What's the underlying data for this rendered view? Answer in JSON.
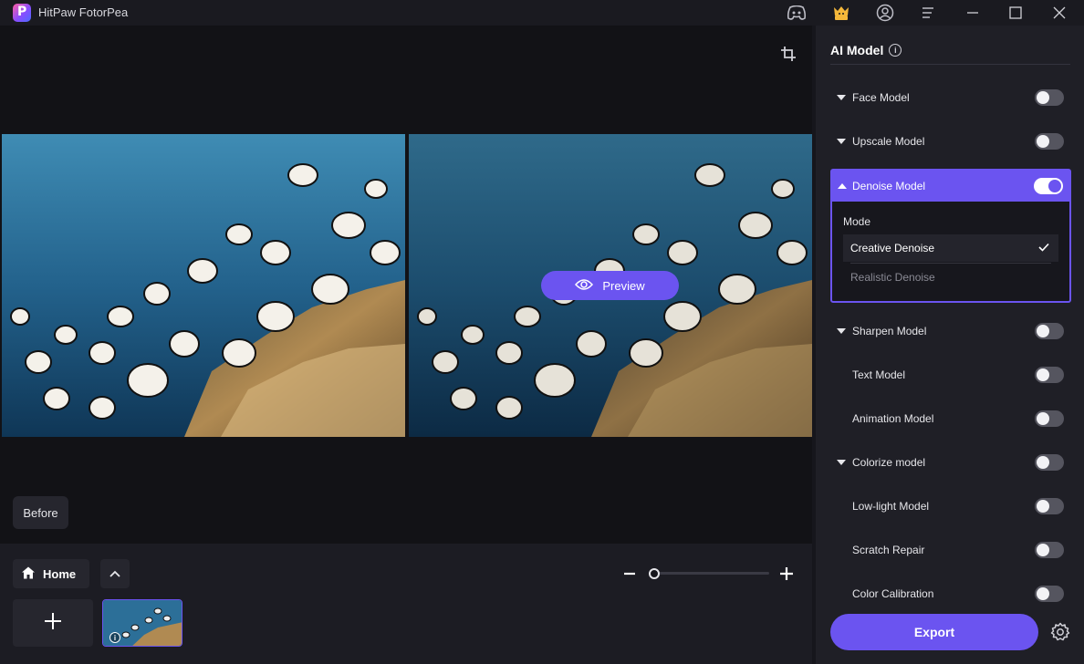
{
  "app": {
    "title": "HitPaw FotorPea",
    "logo_letter": "P"
  },
  "titlebar": {
    "icons": [
      "discord-icon",
      "gift-shop-icon",
      "account-icon",
      "menu-icon",
      "minimize-icon",
      "maximize-icon",
      "close-icon"
    ]
  },
  "canvas": {
    "preview_label": "Preview",
    "before_label": "Before"
  },
  "bottom": {
    "home_label": "Home",
    "zoom_level_fraction": 0.0
  },
  "panel": {
    "title": "AI Model",
    "models": [
      {
        "label": "Face Model",
        "expandable": true,
        "on": false
      },
      {
        "label": "Upscale Model",
        "expandable": true,
        "on": false
      },
      {
        "label": "Denoise Model",
        "expandable": true,
        "expanded": true,
        "on": true
      },
      {
        "label": "Sharpen Model",
        "expandable": true,
        "on": false
      },
      {
        "label": "Text Model",
        "expandable": false,
        "on": false
      },
      {
        "label": "Animation Model",
        "expandable": false,
        "on": false
      },
      {
        "label": "Colorize model",
        "expandable": true,
        "on": false
      },
      {
        "label": "Low-light Model",
        "expandable": false,
        "on": false
      },
      {
        "label": "Scratch Repair",
        "expandable": false,
        "on": false
      },
      {
        "label": "Color Calibration",
        "expandable": false,
        "on": false
      }
    ],
    "denoise": {
      "mode_label": "Mode",
      "options": [
        "Creative Denoise",
        "Realistic Denoise"
      ],
      "selected": "Creative Denoise"
    },
    "export_label": "Export"
  },
  "colors": {
    "accent": "#6b54f0",
    "panel_bg": "#1f1f26",
    "canvas_bg": "#121216"
  }
}
